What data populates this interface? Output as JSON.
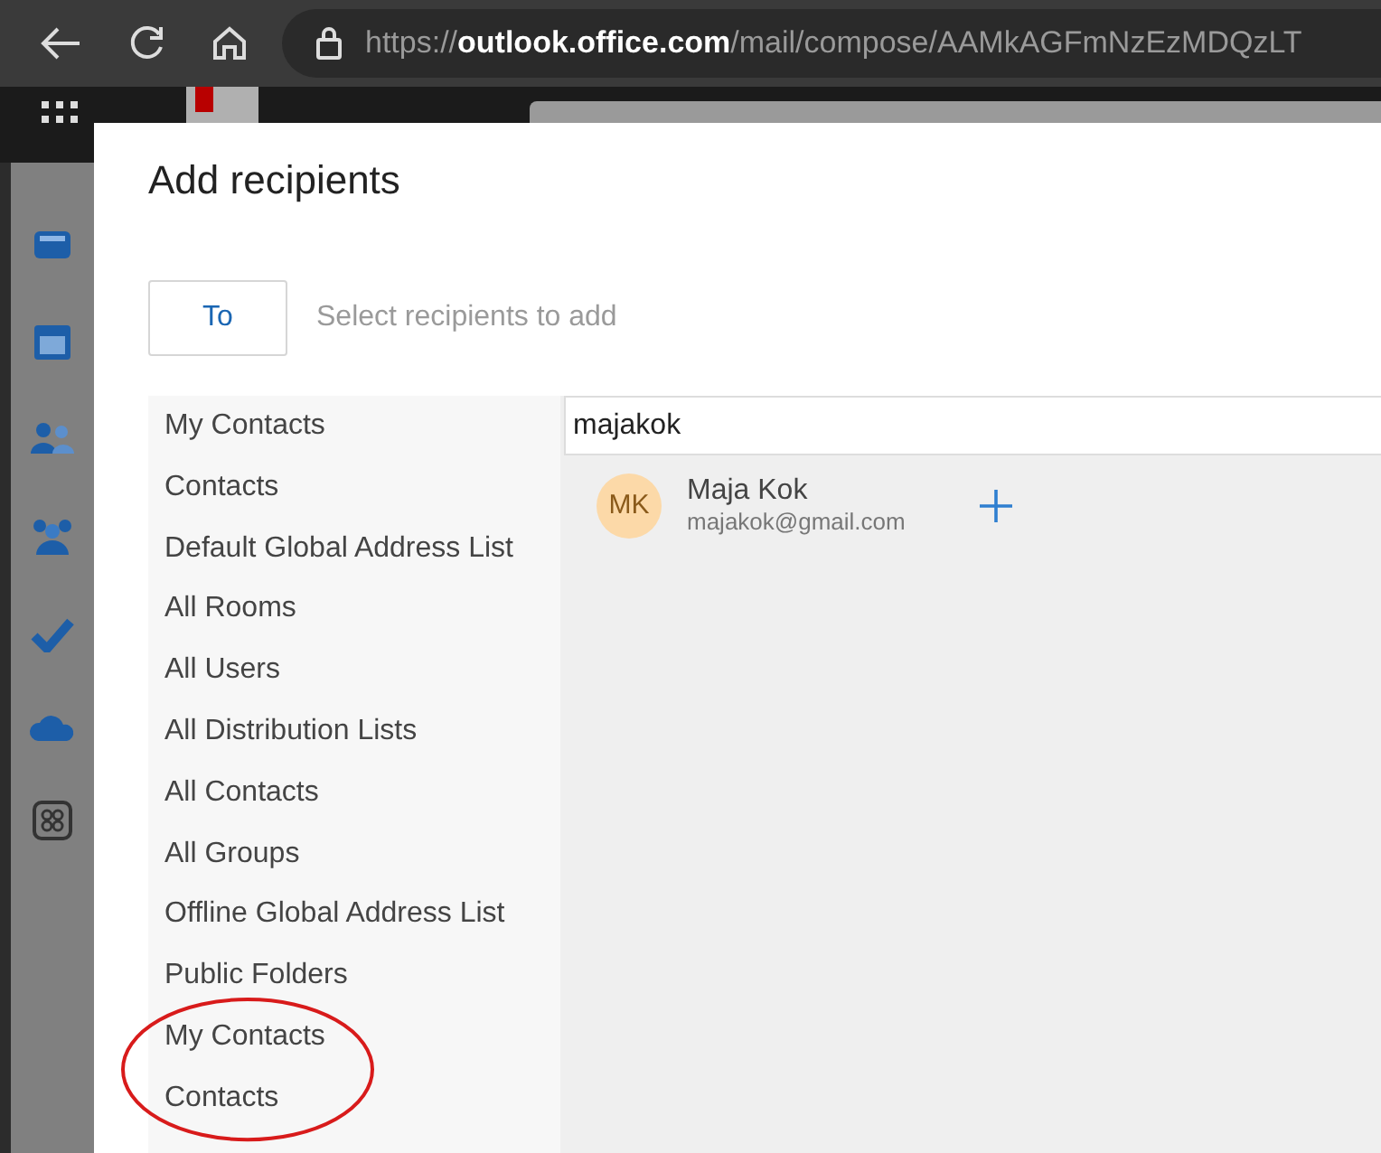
{
  "browser": {
    "url": "https://**outlook.office.com**/mail/compose/AAMkAGFmNzEzMDQzLT"
  },
  "dialog": {
    "title": "Add recipients",
    "to_button": "To",
    "recipients_placeholder": "Select recipients to add"
  },
  "address_lists": [
    {
      "label": "My Contacts",
      "circled": false
    },
    {
      "label": "Contacts",
      "circled": false
    },
    {
      "label": "Default Global Address List",
      "circled": false
    },
    {
      "label": "All Rooms",
      "circled": false
    },
    {
      "label": "All Users",
      "circled": false
    },
    {
      "label": "All Distribution Lists",
      "circled": false
    },
    {
      "label": "All Contacts",
      "circled": false
    },
    {
      "label": "All Groups",
      "circled": false
    },
    {
      "label": "Offline Global Address List",
      "circled": false
    },
    {
      "label": "Public Folders",
      "circled": false
    },
    {
      "label": "My Contacts",
      "circled": true
    },
    {
      "label": "Contacts",
      "circled": true
    }
  ],
  "search": {
    "value": "majakok"
  },
  "results": [
    {
      "initials": "MK",
      "name": "Maja Kok",
      "email": "majakok@gmail.com",
      "color": "#fcd9a8"
    }
  ],
  "annotation": {
    "kind": "circle",
    "color": "#d81b1b"
  }
}
